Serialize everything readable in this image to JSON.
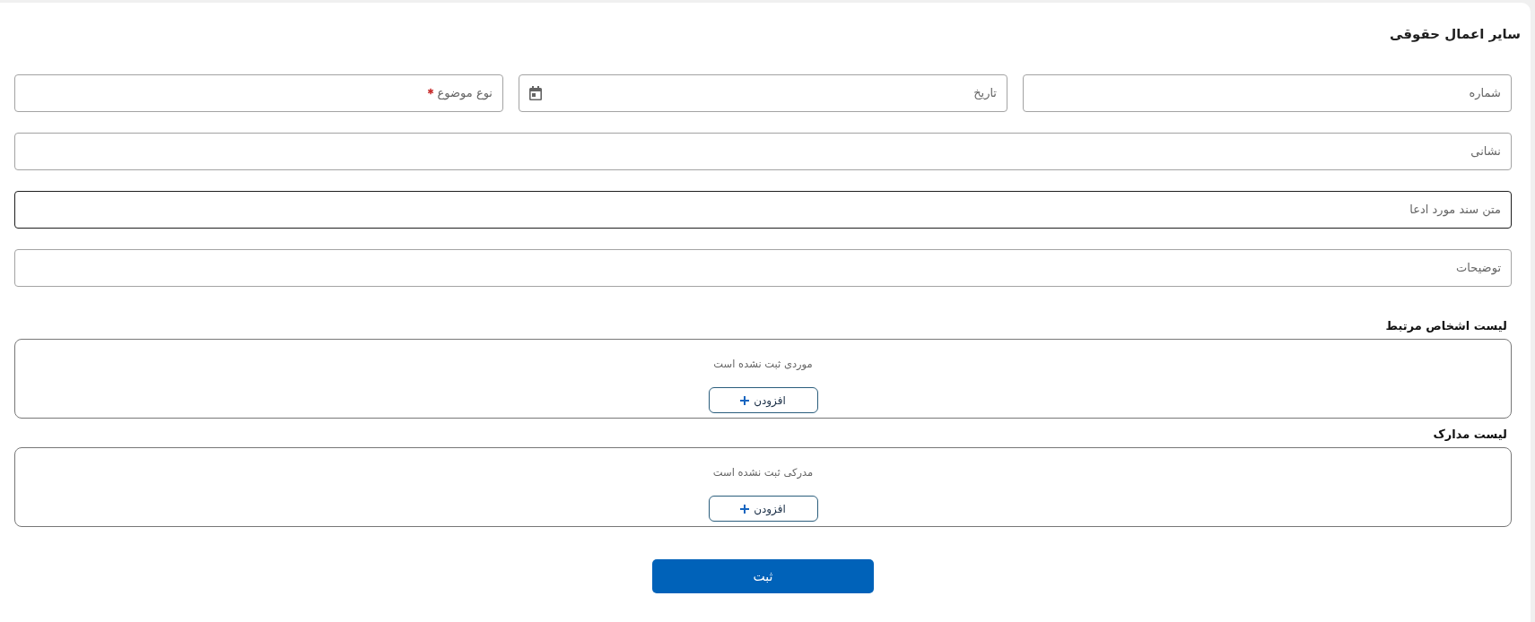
{
  "section": {
    "title": "سایر اعمال حقوقی"
  },
  "rows": [
    {
      "fields": [
        {
          "kind": "text",
          "placeholder": "شماره",
          "required": false,
          "focused": false
        },
        {
          "kind": "date",
          "placeholder": "تاریخ",
          "required": false,
          "focused": false
        },
        {
          "kind": "text",
          "placeholder": "نوع موضوع",
          "required": true,
          "focused": false
        }
      ]
    },
    {
      "fields": [
        {
          "kind": "text",
          "placeholder": "نشانی",
          "required": false,
          "focused": false
        }
      ]
    },
    {
      "fields": [
        {
          "kind": "text",
          "placeholder": "متن سند مورد ادعا",
          "required": false,
          "focused": true
        }
      ]
    },
    {
      "fields": [
        {
          "kind": "text",
          "placeholder": "توضیحات",
          "required": false,
          "focused": false
        }
      ]
    }
  ],
  "lists": [
    {
      "title": "لیست اشخاص مرتبط",
      "empty_message": "موردی ثبت نشده است",
      "add_button": "افزودن"
    },
    {
      "title": "لیست مدارک",
      "empty_message": "مدرکی ثبت نشده است",
      "add_button": "افزودن"
    }
  ],
  "submit_button": "ثبت"
}
